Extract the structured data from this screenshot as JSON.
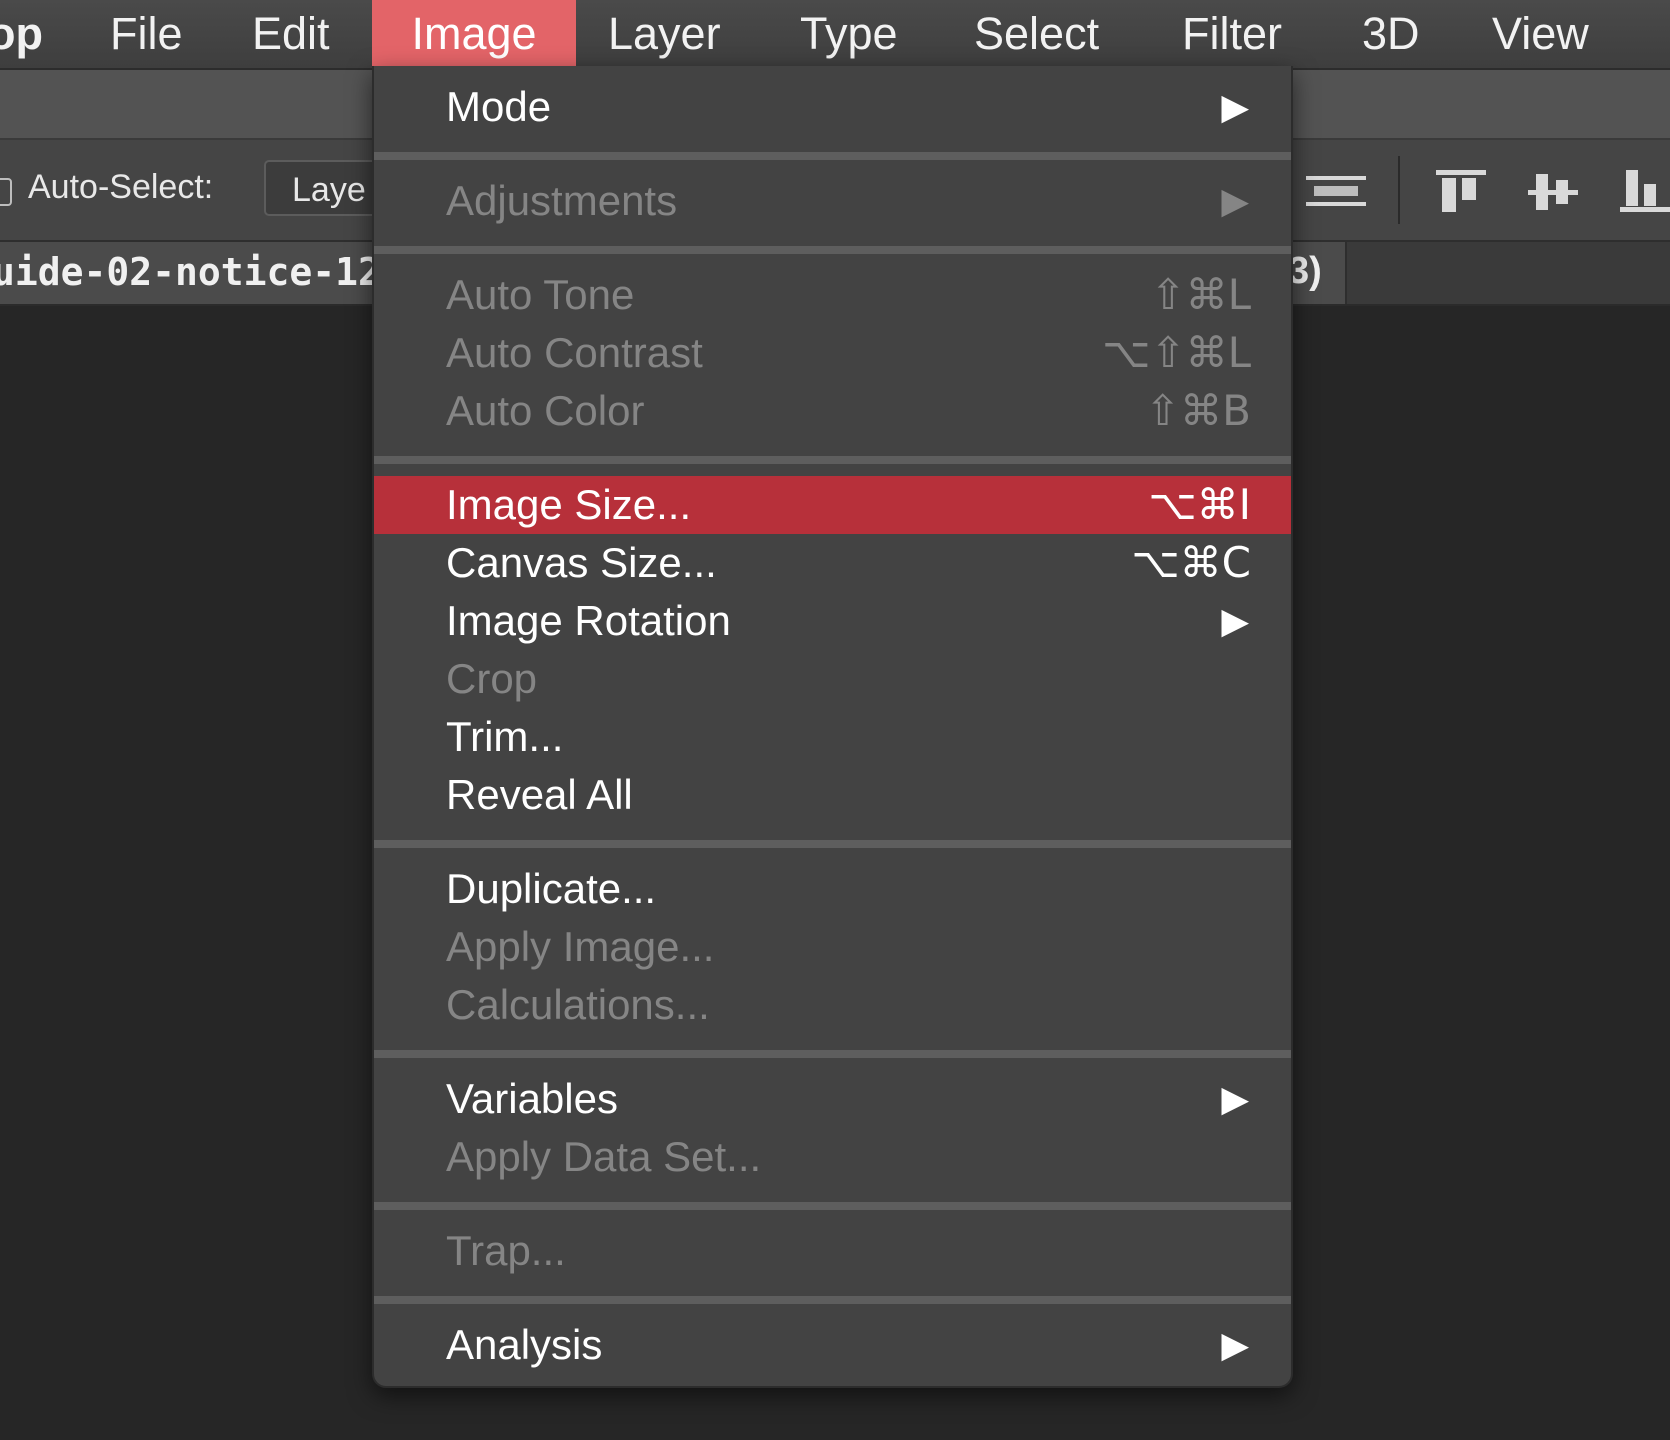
{
  "menubar": {
    "items": [
      {
        "label": "op"
      },
      {
        "label": "File"
      },
      {
        "label": "Edit"
      },
      {
        "label": "Image"
      },
      {
        "label": "Layer"
      },
      {
        "label": "Type"
      },
      {
        "label": "Select"
      },
      {
        "label": "Filter"
      },
      {
        "label": "3D"
      },
      {
        "label": "View"
      }
    ],
    "active_item": "Image",
    "active_color": "#e36468"
  },
  "options_bar": {
    "auto_select_label": "Auto-Select:",
    "layer_select_value": "Laye",
    "align_icons": [
      "align-horizontal-centers-icon",
      "align-top-edges-icon",
      "align-vertical-centers-icon",
      "align-bottom-edges-icon"
    ]
  },
  "document_tab": {
    "title": "uide-02-notice-12",
    "tail": "3)"
  },
  "image_menu": {
    "highlight_color": "#b7303a",
    "items": [
      {
        "label": "Mode",
        "shortcut": "",
        "submenu": "▶"
      },
      {
        "label": "Adjustments",
        "shortcut": "",
        "submenu": "▶"
      },
      {
        "label": "Auto Tone",
        "shortcut": "⇧⌘L",
        "submenu": ""
      },
      {
        "label": "Auto Contrast",
        "shortcut": "⌥⇧⌘L",
        "submenu": ""
      },
      {
        "label": "Auto Color",
        "shortcut": "⇧⌘B",
        "submenu": ""
      },
      {
        "label": "Image Size...",
        "shortcut": "⌥⌘I",
        "submenu": ""
      },
      {
        "label": "Canvas Size...",
        "shortcut": "⌥⌘C",
        "submenu": ""
      },
      {
        "label": "Image Rotation",
        "shortcut": "",
        "submenu": "▶"
      },
      {
        "label": "Crop",
        "shortcut": "",
        "submenu": ""
      },
      {
        "label": "Trim...",
        "shortcut": "",
        "submenu": ""
      },
      {
        "label": "Reveal All",
        "shortcut": "",
        "submenu": ""
      },
      {
        "label": "Duplicate...",
        "shortcut": "",
        "submenu": ""
      },
      {
        "label": "Apply Image...",
        "shortcut": "",
        "submenu": ""
      },
      {
        "label": "Calculations...",
        "shortcut": "",
        "submenu": ""
      },
      {
        "label": "Variables",
        "shortcut": "",
        "submenu": "▶"
      },
      {
        "label": "Apply Data Set...",
        "shortcut": "",
        "submenu": ""
      },
      {
        "label": "Trap...",
        "shortcut": "",
        "submenu": ""
      },
      {
        "label": "Analysis",
        "shortcut": "",
        "submenu": "▶"
      }
    ]
  }
}
